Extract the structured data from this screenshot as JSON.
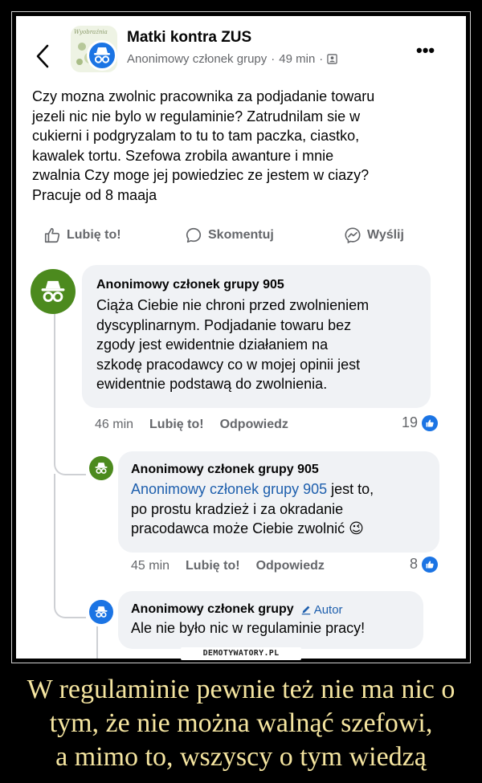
{
  "header": {
    "group_name": "Matki kontra ZUS",
    "author": "Anonimowy członek grupy",
    "time": "49 min",
    "separator": "·",
    "more_label": "•••",
    "group_avatar_text": "Wyobraźnia"
  },
  "post": {
    "lines": [
      "Czy mozna zwolnic pracownika za podjadanie towaru",
      "jezeli nic nie bylo w regulaminie? Zatrudnilam sie w",
      "cukierni i podgryzalam to tu to tam paczka, ciastko,",
      "kawalek tortu. Szefowa zrobila awanture i mnie",
      "zwalnia Czy moge jej powiedziec ze jestem w ciazy?",
      "Pracuje od 8 maaja"
    ]
  },
  "actions": {
    "like": "Lubię to!",
    "comment": "Skomentuj",
    "share": "Wyślij"
  },
  "comments": [
    {
      "author": "Anonimowy członek grupy 905",
      "lines": [
        "Ciąża Ciebie nie chroni przed zwolnieniem",
        "dyscyplinarnym. Podjadanie towaru bez",
        "zgody jest ewidentnie działaniem na",
        "szkodę pracodawcy co w mojej opinii jest",
        "ewidentnie podstawą do zwolnienia."
      ],
      "time": "46 min",
      "like": "Lubię to!",
      "reply": "Odpowiedz",
      "likes": "19"
    },
    {
      "author": "Anonimowy członek grupy 905",
      "mention": "Anonimowy członek grupy 905",
      "first_line_rest": " jest to,",
      "lines": [
        "po prostu kradzież i za okradanie",
        "pracodawca może Ciebie zwolnić"
      ],
      "emoji": "😉",
      "time": "45 min",
      "like": "Lubię to!",
      "reply": "Odpowiedz",
      "likes": "8"
    },
    {
      "author": "Anonimowy członek grupy",
      "badge": "Autor",
      "lines": [
        "Ale nie było nic w regulaminie pracy!"
      ]
    }
  ],
  "watermark": "DEMOTYWATORY.PL",
  "caption": {
    "lines": [
      "W regulaminie pewnie też nie ma nic o",
      "tym, że nie można walnąć szefowi,",
      "a mimo to, wszyscy o tym wiedzą"
    ]
  },
  "colors": {
    "background": "#000000",
    "caption": "#f5e5a0",
    "facebook_blue": "#1b74e4",
    "anon_green": "#4c8a1e",
    "bubble": "#f0f2f5",
    "secondary_text": "#65676b"
  }
}
